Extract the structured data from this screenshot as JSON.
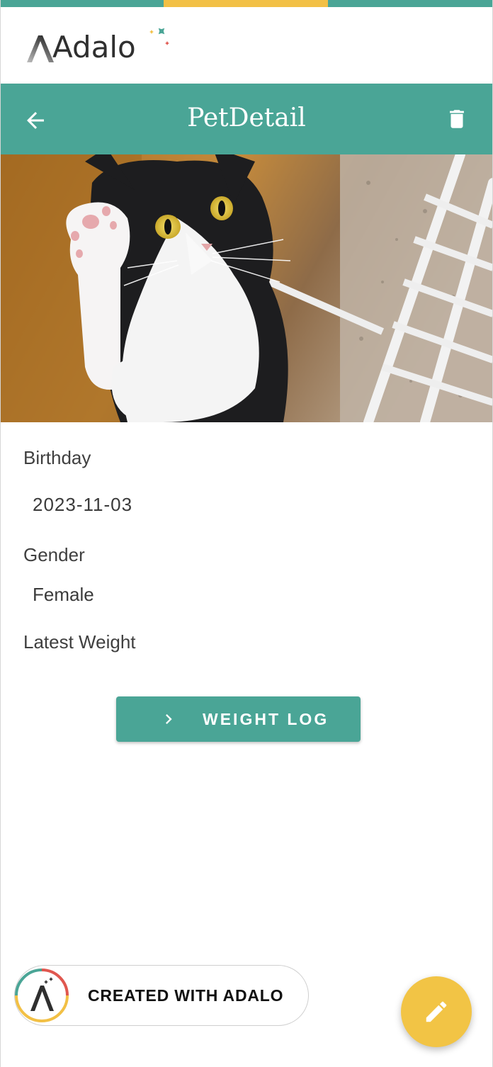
{
  "brand": {
    "name": "Adalo"
  },
  "app_bar": {
    "title": "PetDetail",
    "back_icon": "arrow-left-icon",
    "delete_icon": "trash-icon"
  },
  "pet": {
    "photo": "black-and-white-cat-raising-paw",
    "fields": {
      "birthday_label": "Birthday",
      "birthday_value": "2023-11-03",
      "gender_label": "Gender",
      "gender_value": "Female",
      "weight_label": "Latest Weight"
    }
  },
  "weight_log_button": {
    "label": "WEIGHT LOG",
    "icon": "chevron-right-icon"
  },
  "badge": {
    "label": "CREATED WITH ADALO"
  },
  "fab": {
    "icon": "pencil-icon"
  },
  "colors": {
    "primary": "#4aa596",
    "accent": "#f2c445",
    "progress_segment": "#f2c045"
  }
}
